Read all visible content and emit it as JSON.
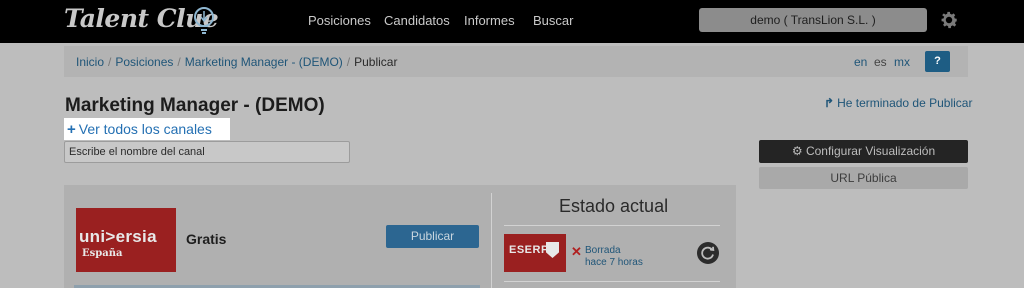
{
  "app": {
    "logo": "Talent Clue",
    "nav": [
      "Posiciones",
      "Candidatos",
      "Informes",
      "Buscar"
    ],
    "account": "demo ( TransLion S.L. )"
  },
  "breadcrumb": {
    "items": [
      "Inicio",
      "Posiciones",
      "Marketing Manager - (DEMO)"
    ],
    "current": "Publicar",
    "langs": [
      "en",
      "es",
      "mx"
    ],
    "help": "?"
  },
  "page": {
    "title": "Marketing Manager - (DEMO)",
    "done_link": "He terminado de Publicar",
    "see_all": "Ver todos los canales",
    "channel_placeholder": "Escribe el nombre del canal",
    "configure_button": "Configurar Visualización",
    "public_url_button": "URL Pública"
  },
  "channel": {
    "logo_word": "uni>ersia",
    "logo_country": "España",
    "price": "Gratis",
    "publish_button": "Publicar"
  },
  "status": {
    "title": "Estado actual",
    "logo_word": "ESERP",
    "state": "Borrada",
    "time": "hace 7 horas"
  },
  "colors": {
    "accent": "#2470b3",
    "brand_red": "#9a2020",
    "nav_bg": "#000000",
    "overlay_gray": "#bdbdbd"
  }
}
